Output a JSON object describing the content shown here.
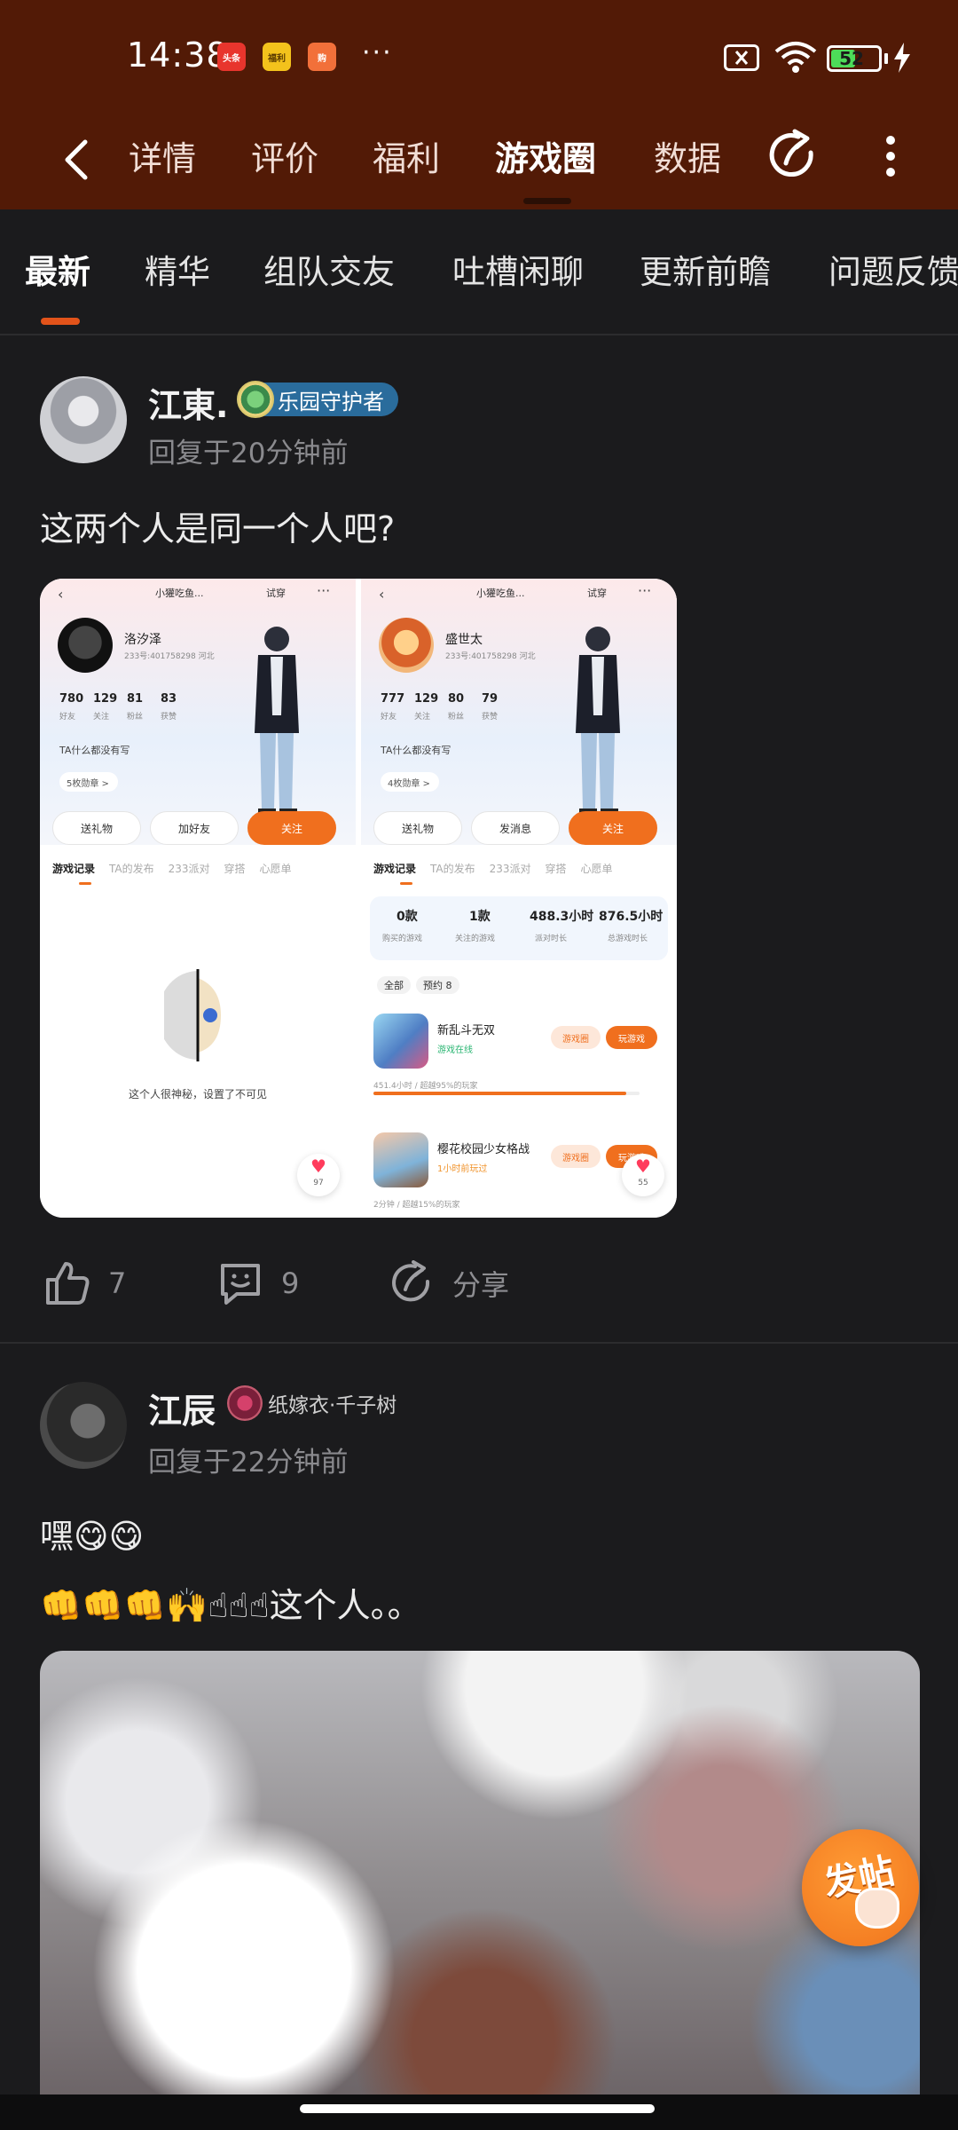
{
  "status_bar": {
    "time": "14:38",
    "app_badges": [
      {
        "label": "头条",
        "color": "#e8352d"
      },
      {
        "label": "福利",
        "color": "#f3c21c"
      },
      {
        "label": "购",
        "color": "#f2703a"
      }
    ],
    "more": "···",
    "battery": "52",
    "battery_fraction": 0.52
  },
  "nav": {
    "tabs": [
      {
        "label": "详情"
      },
      {
        "label": "评价"
      },
      {
        "label": "福利"
      },
      {
        "label": "游戏圈"
      },
      {
        "label": "数据"
      }
    ],
    "active_tab": "游戏圈",
    "colors": {
      "header_bg": "#521a06",
      "accent": "#e2531a"
    }
  },
  "subtabs": {
    "items": [
      "最新",
      "精华",
      "组队交友",
      "吐槽闲聊",
      "更新前瞻",
      "问题反馈"
    ],
    "active": "最新"
  },
  "post1": {
    "username": "江東.",
    "badge": "乐园守护者",
    "reply_time": "回复于20分钟前",
    "text": "这两个人是同一个人吧?",
    "likes": "7",
    "comments": "9",
    "share": "分享",
    "screenshot": {
      "left": {
        "top_chip": "小獾吃鱼...",
        "try_label": "试穿",
        "name": "洛汐泽",
        "id": "233号:401758298 河北",
        "stats": [
          "780",
          "129",
          "81",
          "83"
        ],
        "stat_labels": [
          "好友",
          "关注",
          "粉丝",
          "获赞"
        ],
        "bio": "TA什么都没有写",
        "medal": "5枚勋章 >",
        "btn_gift": "送礼物",
        "btn_add": "加好友",
        "btn_follow": "关注",
        "tabs": [
          "游戏记录",
          "TA的发布",
          "233派对",
          "穿搭",
          "心愿单"
        ],
        "private_text": "这个人很神秘，设置了不可见",
        "heart_count": "97"
      },
      "right": {
        "top_chip": "小獾吃鱼...",
        "try_label": "试穿",
        "name": "盛世太",
        "id": "233号:401758298 河北",
        "stats": [
          "777",
          "129",
          "80",
          "79"
        ],
        "stat_labels": [
          "好友",
          "关注",
          "粉丝",
          "获赞"
        ],
        "bio": "TA什么都没有写",
        "medal": "4枚勋章 >",
        "btn_gift": "送礼物",
        "btn_msg": "发消息",
        "btn_follow": "关注",
        "tabs": [
          "游戏记录",
          "TA的发布",
          "233派对",
          "穿搭",
          "心愿单"
        ],
        "summary": [
          {
            "value": "0款",
            "label": "购买的游戏"
          },
          {
            "value": "1款",
            "label": "关注的游戏"
          },
          {
            "value": "488.3小时",
            "label": "派对时长"
          },
          {
            "value": "876.5小时",
            "label": "总游戏时长"
          }
        ],
        "filters": [
          "全部",
          "预约 8"
        ],
        "games": [
          {
            "name": "新乱斗无双",
            "status": "游戏在线",
            "tag": "游戏圈",
            "play": "玩游戏",
            "progress_text": "451.4小时 / 超越95%的玩家",
            "progress": 0.95
          },
          {
            "name": "樱花校园少女格战",
            "status": "1小时前玩过",
            "tag": "游戏圈",
            "play": "玩游戏",
            "progress_text": "2分钟 / 超越15%的玩家",
            "progress": 0.15
          }
        ],
        "heart_count": "55"
      }
    }
  },
  "post2": {
    "username": "江辰",
    "badge": "纸嫁衣·千子树",
    "reply_time": "回复于22分钟前",
    "line1": "嘿😋😋",
    "line2": "👊👊👊🙌☝☝☝这个人。。"
  },
  "fab": {
    "label": "发帖"
  }
}
